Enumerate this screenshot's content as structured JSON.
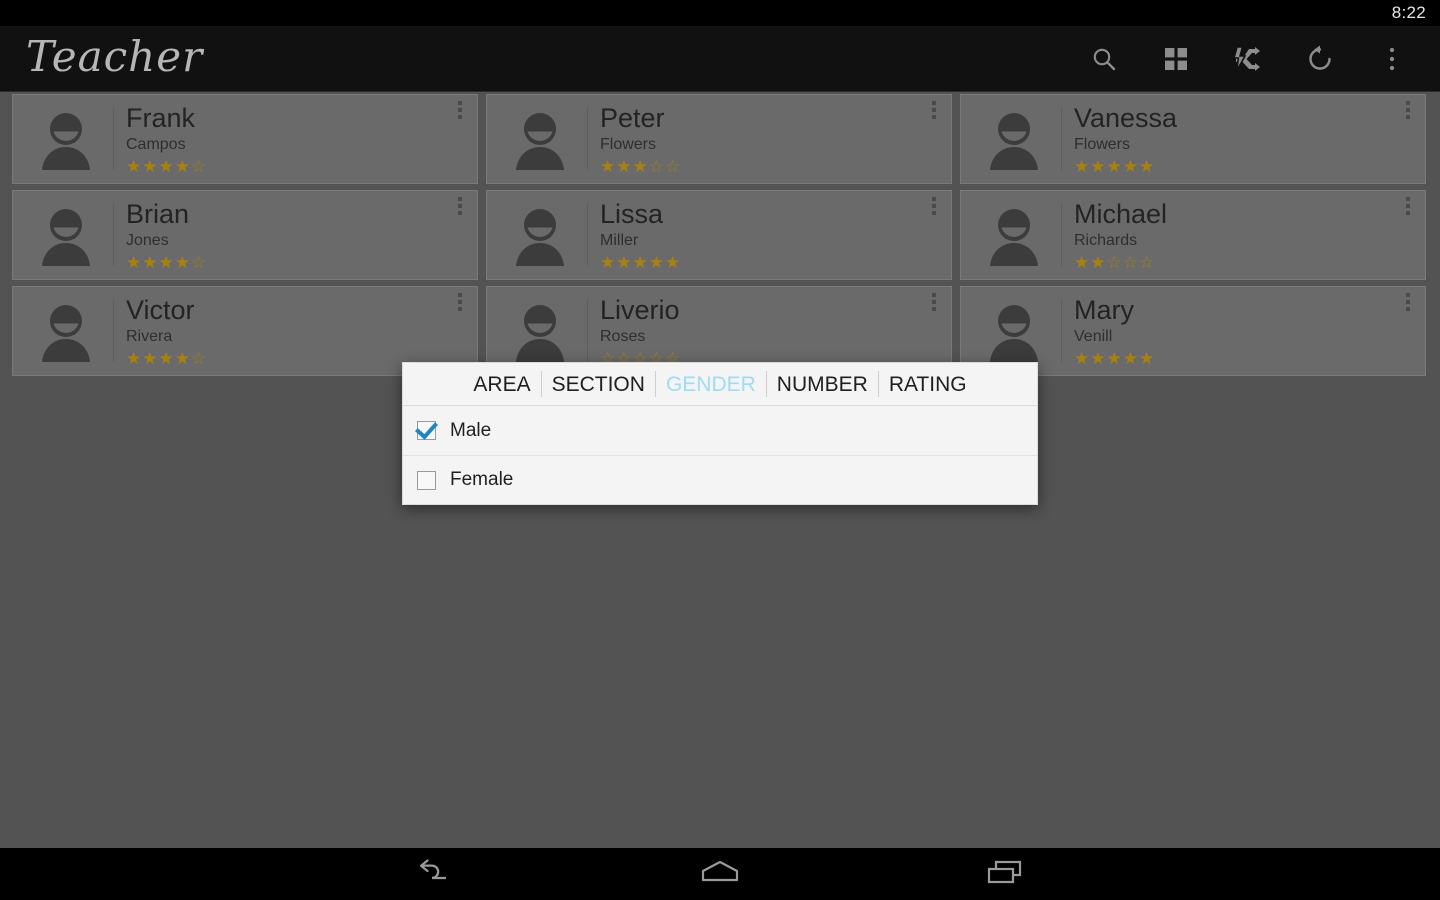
{
  "status_bar": {
    "time": "8:22"
  },
  "action_bar": {
    "title": "Teacher",
    "icons": [
      {
        "name": "search-icon",
        "label": "Search"
      },
      {
        "name": "grid-icon",
        "label": "Grid view"
      },
      {
        "name": "shuffle-bolt-icon",
        "label": "Shuffle"
      },
      {
        "name": "refresh-icon",
        "label": "Refresh"
      },
      {
        "name": "overflow-menu-icon",
        "label": "More options"
      }
    ]
  },
  "cards": [
    {
      "first_name": "Frank",
      "last_name": "Campos",
      "rating": 4
    },
    {
      "first_name": "Peter",
      "last_name": "Flowers",
      "rating": 3
    },
    {
      "first_name": "Vanessa",
      "last_name": "Flowers",
      "rating": 5
    },
    {
      "first_name": "Brian",
      "last_name": "Jones",
      "rating": 4
    },
    {
      "first_name": "Lissa",
      "last_name": "Miller",
      "rating": 5
    },
    {
      "first_name": "Michael",
      "last_name": "Richards",
      "rating": 2
    },
    {
      "first_name": "Victor",
      "last_name": "Rivera",
      "rating": 4
    },
    {
      "first_name": "Liverio",
      "last_name": "Roses",
      "rating": 0
    },
    {
      "first_name": "Mary",
      "last_name": "Venill",
      "rating": 5
    }
  ],
  "rating_max": 5,
  "star_glyphs": {
    "filled": "★",
    "empty": "☆"
  },
  "dialog": {
    "tabs": [
      {
        "label": "AREA",
        "active": false
      },
      {
        "label": "SECTION",
        "active": false
      },
      {
        "label": "GENDER",
        "active": true
      },
      {
        "label": "NUMBER",
        "active": false
      },
      {
        "label": "RATING",
        "active": false
      }
    ],
    "options": [
      {
        "label": "Male",
        "checked": true
      },
      {
        "label": "Female",
        "checked": false
      }
    ]
  },
  "nav_bar": {
    "buttons": [
      {
        "name": "back-icon",
        "label": "Back"
      },
      {
        "name": "home-icon",
        "label": "Home"
      },
      {
        "name": "recents-icon",
        "label": "Recent apps"
      }
    ]
  },
  "colors": {
    "accent_tab": "#9ddcf5",
    "checkbox_check": "#1b87c9",
    "star": "#a8820e",
    "scrim": "#535353"
  }
}
